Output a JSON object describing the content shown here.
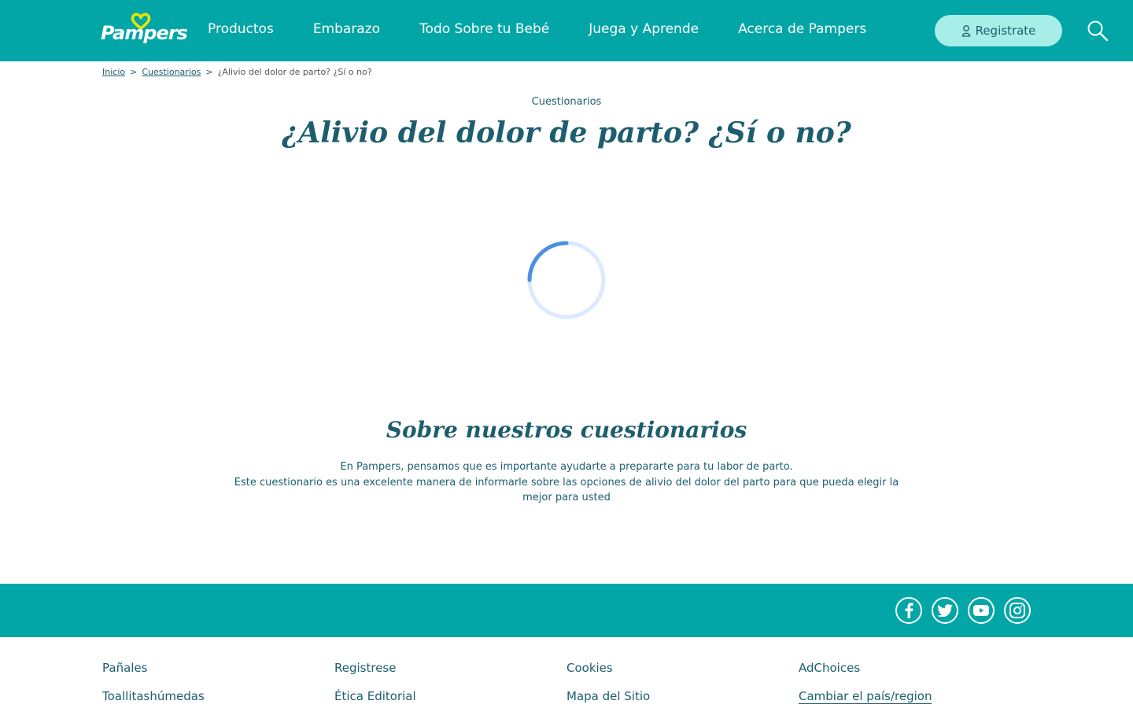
{
  "header": {
    "logo_text": "Pampers",
    "nav": [
      "Productos",
      "Embarazo",
      "Todo Sobre tu Bebé",
      "Juega y Aprende",
      "Acerca de Pampers"
    ],
    "register_label": "Registrate",
    "colors": {
      "header_bg": "#02a6a6",
      "register_bg": "#a8eee8",
      "logo_heart": "#e6e600"
    }
  },
  "breadcrumb": {
    "home": "Inicio",
    "section": "Cuestionarios",
    "current": "¿Alivio del dolor de parto? ¿Sí o no?",
    "separator": ">"
  },
  "main": {
    "category": "Cuestionarios",
    "title": "¿Alivio del dolor de parto? ¿Sí o no?",
    "loading": true
  },
  "about": {
    "title": "Sobre nuestros cuestionarios",
    "line1": "En Pampers, pensamos que es importante ayudarte a prepararte para tu labor de parto.",
    "line2": "Este cuestionario es una excelente manera de informarle sobre las opciones de alivio del dolor del parto para que pueda elegir la mejor para usted"
  },
  "footer": {
    "social_icons": [
      "facebook-icon",
      "twitter-icon",
      "youtube-icon",
      "instagram-icon"
    ],
    "columns": [
      [
        "Pañales",
        "Toallitashúmedas"
      ],
      [
        "Registrese",
        "Ética Editorial"
      ],
      [
        "Cookies",
        "Mapa del Sitio"
      ],
      [
        "AdChoices",
        "Cambiar el país/region"
      ]
    ]
  }
}
